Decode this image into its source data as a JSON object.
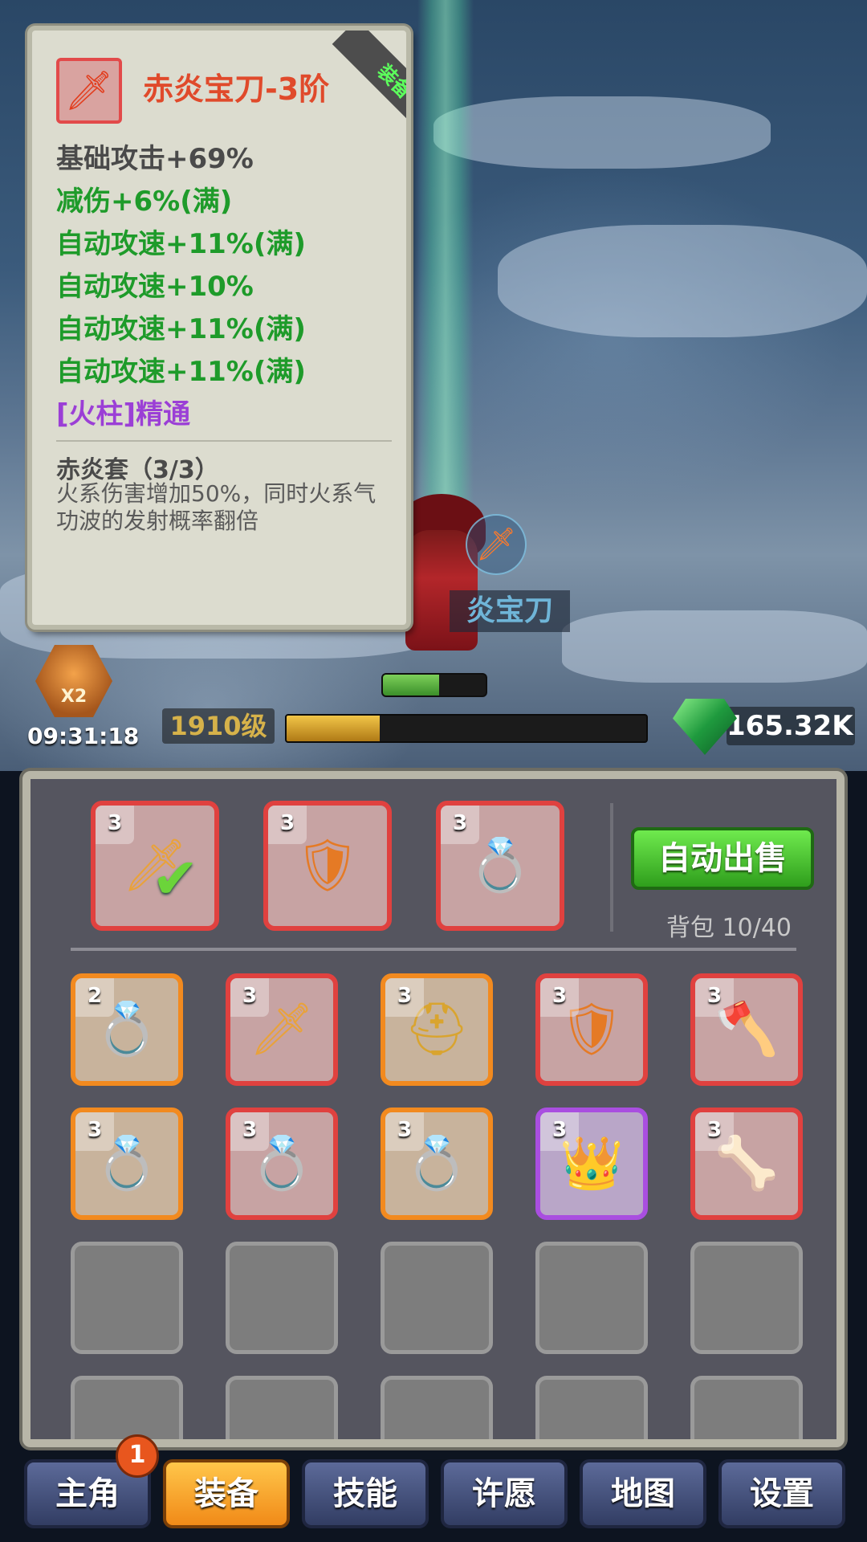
{
  "tooltip": {
    "item_name": "赤炎宝刀-3阶",
    "equipped_tag": "装备中",
    "stats": [
      {
        "text": "基础攻击+69%",
        "color": "#4a4a4a"
      },
      {
        "text": "减伤+6%(满)",
        "color": "#1e9b2a"
      },
      {
        "text": "自动攻速+11%(满)",
        "color": "#1e9b2a"
      },
      {
        "text": "自动攻速+10%",
        "color": "#1e9b2a"
      },
      {
        "text": "自动攻速+11%(满)",
        "color": "#1e9b2a"
      },
      {
        "text": "自动攻速+11%(满)",
        "color": "#1e9b2a"
      },
      {
        "text": "[火柱]精通",
        "color": "#9b3fd6"
      }
    ],
    "set_title": "赤炎套（3/3）",
    "set_desc": "火系伤害增加50%，同时火系气功波的发射概率翻倍"
  },
  "hud": {
    "boost_label": "X2",
    "timer": "09:31:18",
    "level": "1910级",
    "xp_fraction": 0.26,
    "hp_fraction": 0.55,
    "gems": "165.32K",
    "weapon_label": "炎宝刀"
  },
  "equipped": [
    {
      "tier": "3",
      "icon": "dagger-icon",
      "checked": true
    },
    {
      "tier": "3",
      "icon": "armor-icon",
      "checked": false
    },
    {
      "tier": "3",
      "icon": "ring-icon",
      "checked": false
    }
  ],
  "auto_sell": "自动出售",
  "bag": "背包 10/40",
  "inventory": [
    {
      "tier": "2",
      "rarity": "orange",
      "icon": "ring-icon"
    },
    {
      "tier": "3",
      "rarity": "red",
      "icon": "dagger-icon"
    },
    {
      "tier": "3",
      "rarity": "orange",
      "icon": "helmet-icon"
    },
    {
      "tier": "3",
      "rarity": "red",
      "icon": "armor-icon"
    },
    {
      "tier": "3",
      "rarity": "red",
      "icon": "axe-icon"
    },
    {
      "tier": "3",
      "rarity": "orange",
      "icon": "ring-icon"
    },
    {
      "tier": "3",
      "rarity": "red",
      "icon": "ring-icon"
    },
    {
      "tier": "3",
      "rarity": "orange",
      "icon": "ring-icon"
    },
    {
      "tier": "3",
      "rarity": "purple",
      "icon": "crown-ring-icon"
    },
    {
      "tier": "3",
      "rarity": "red",
      "icon": "shoulder-armor-icon"
    }
  ],
  "nav": {
    "items": [
      "主角",
      "装备",
      "技能",
      "许愿",
      "地图",
      "设置"
    ],
    "active": 1,
    "badge": "1"
  }
}
